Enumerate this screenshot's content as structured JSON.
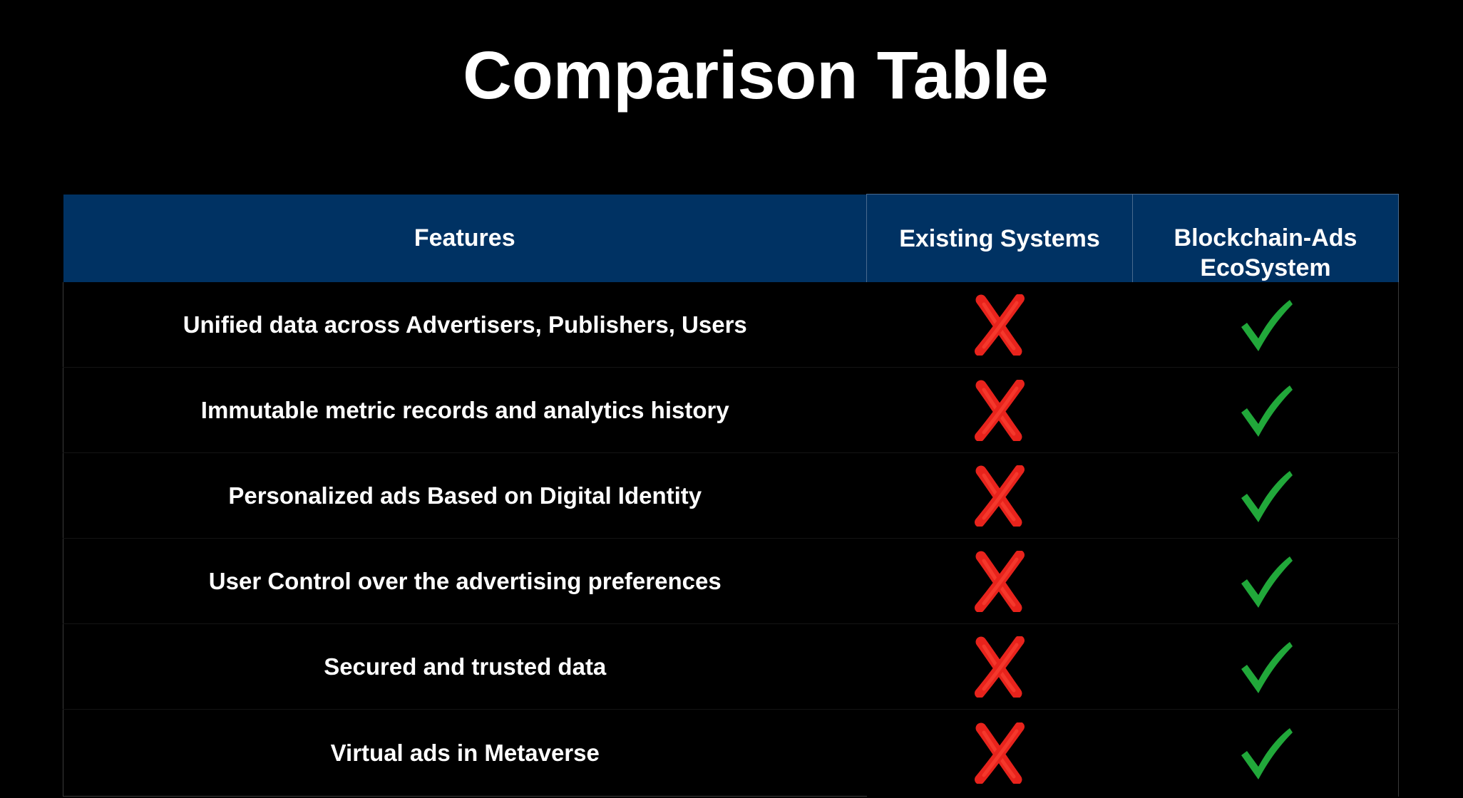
{
  "title": "Comparison Table",
  "colors": {
    "header_bg": "#003263",
    "cross": "#e8231c",
    "check": "#21a83a"
  },
  "table": {
    "headers": [
      "Features",
      "Existing Systems",
      "Blockchain-Ads EcoSystem"
    ],
    "rows": [
      {
        "feature": "Unified data across Advertisers, Publishers, Users",
        "existing": "cross-icon",
        "blockchain": "check-icon"
      },
      {
        "feature": "Immutable metric records and analytics history",
        "existing": "cross-icon",
        "blockchain": "check-icon"
      },
      {
        "feature": "Personalized ads Based on Digital Identity",
        "existing": "cross-icon",
        "blockchain": "check-icon"
      },
      {
        "feature": "User Control over the advertising preferences",
        "existing": "cross-icon",
        "blockchain": "check-icon"
      },
      {
        "feature": "Secured and trusted data",
        "existing": "cross-icon",
        "blockchain": "check-icon"
      },
      {
        "feature": "Virtual ads in Metaverse",
        "existing": "cross-icon",
        "blockchain": "check-icon"
      }
    ]
  }
}
